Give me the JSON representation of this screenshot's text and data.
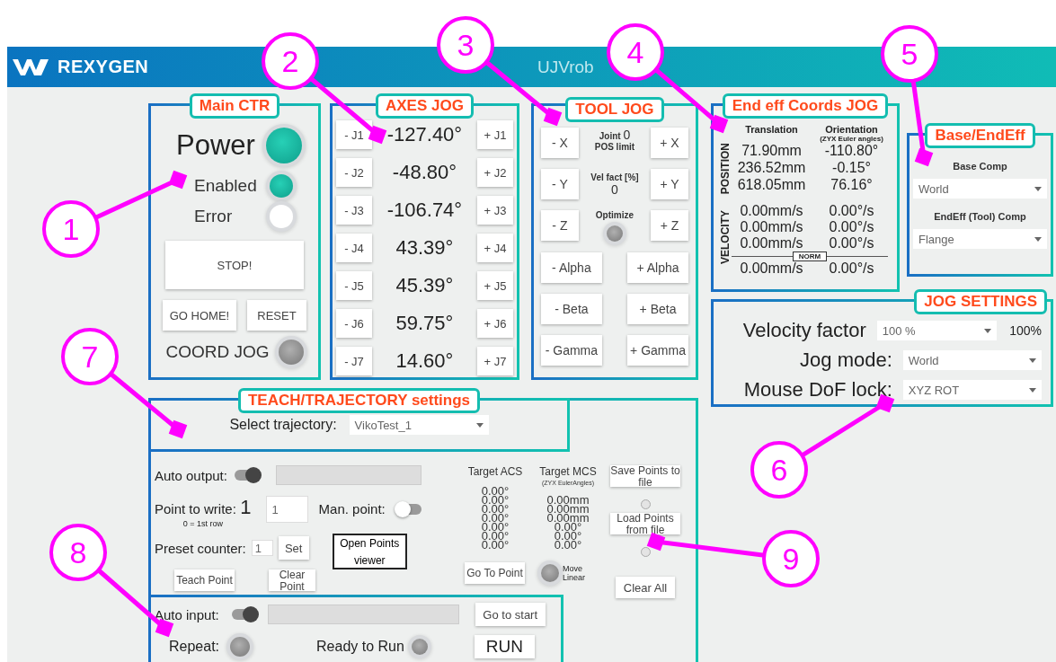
{
  "header": {
    "brand": "REXYGEN",
    "title": "UJVrob"
  },
  "main_ctr": {
    "title": "Main CTR",
    "indicators": [
      {
        "label": "Power",
        "on": true
      },
      {
        "label": "Enabled",
        "on": true
      },
      {
        "label": "Error",
        "on": false
      }
    ],
    "stop_button": "STOP!",
    "buttons": [
      "GO HOME!",
      "RESET"
    ],
    "coord_jog": {
      "label": "COORD JOG",
      "on": false
    }
  },
  "axes_jog": {
    "title": "AXES JOG",
    "joints": [
      {
        "minus": "- J1",
        "value": "-127.40°",
        "plus": "+ J1"
      },
      {
        "minus": "- J2",
        "value": "-48.80°",
        "plus": "+ J2"
      },
      {
        "minus": "- J3",
        "value": "-106.74°",
        "plus": "+ J3"
      },
      {
        "minus": "- J4",
        "value": "43.39°",
        "plus": "+ J4"
      },
      {
        "minus": "- J5",
        "value": "45.39°",
        "plus": "+ J5"
      },
      {
        "minus": "- J6",
        "value": "59.75°",
        "plus": "+ J6"
      },
      {
        "minus": "- J7",
        "value": "14.60°",
        "plus": "+ J7"
      }
    ]
  },
  "tool_jog": {
    "title": "TOOL JOG",
    "joint_label": "Joint",
    "joint_value": "0",
    "pos_limit": "POS limit",
    "vel_fact_label": "Vel fact  [%]",
    "vel_fact_value": "0",
    "optimize": {
      "label": "Optimize",
      "on": false
    },
    "linear_buttons": [
      {
        "minus": "- X",
        "plus": "+ X"
      },
      {
        "minus": "- Y",
        "plus": "+ Y"
      },
      {
        "minus": "- Z",
        "plus": "+ Z"
      }
    ],
    "angular_buttons": [
      {
        "minus": "- Alpha",
        "plus": "+ Alpha"
      },
      {
        "minus": "- Beta",
        "plus": "+ Beta"
      },
      {
        "minus": "- Gamma",
        "plus": "+ Gamma"
      }
    ]
  },
  "end_eff": {
    "title": "End eff Coords JOG",
    "translation_header": "Translation",
    "orientation_header": "Orientation",
    "orientation_note": "(ZYX Euler angles)",
    "position_label": "POSITION",
    "position_rows": [
      {
        "translation": "71.90mm",
        "orientation": "-110.80°"
      },
      {
        "translation": "236.52mm",
        "orientation": "-0.15°"
      },
      {
        "translation": "618.05mm",
        "orientation": "76.16°"
      }
    ],
    "velocity_label": "VELOCITY",
    "velocity_rows": [
      {
        "translation": "0.00mm/s",
        "orientation": "0.00°/s"
      },
      {
        "translation": "0.00mm/s",
        "orientation": "0.00°/s"
      },
      {
        "translation": "0.00mm/s",
        "orientation": "0.00°/s"
      }
    ],
    "norm_label": "NORM",
    "norm_row": {
      "translation": "0.00mm/s",
      "orientation": "0.00°/s"
    }
  },
  "base_endeff": {
    "title": "Base/EndEff",
    "fields": [
      {
        "label": "Base Comp",
        "value": "World"
      },
      {
        "label": "EndEff (Tool) Comp",
        "value": "Flange"
      }
    ]
  },
  "jog_settings": {
    "title": "JOG SETTINGS",
    "rows": [
      {
        "label": "Velocity factor",
        "value": "100 %",
        "reading": "100%"
      },
      {
        "label": "Jog mode:",
        "value": "World"
      },
      {
        "label": "Mouse DoF lock:",
        "value": "XYZ ROT"
      }
    ]
  },
  "teach": {
    "title": "TEACH/TRAJECTORY settings",
    "select_label": "Select trajectory:",
    "select_value": "VikoTest_1",
    "auto_output": {
      "label": "Auto output:",
      "on": true
    },
    "point_to_write": {
      "label": "Point to write:",
      "value": "1",
      "note": "0 = 1st row",
      "input": "1"
    },
    "man_point": {
      "label": "Man. point:",
      "on": false
    },
    "preset_counter": {
      "label": "Preset counter:",
      "input": "1",
      "button": "Set"
    },
    "open_viewer": "Open Points viewer",
    "teach_button": "Teach Point",
    "clear_button": "Clear Point",
    "target_acs": {
      "header": "Target ACS",
      "values": [
        "0.00°",
        "0.00°",
        "0.00°",
        "0.00°",
        "0.00°",
        "0.00°",
        "0.00°"
      ]
    },
    "target_mcs": {
      "header": "Target MCS",
      "note": "(ZYX EulerAngles)",
      "values": [
        "0.00mm",
        "0.00mm",
        "0.00mm",
        "0.00°",
        "0.00°",
        "0.00°"
      ]
    },
    "save_button": "Save Points to file",
    "save_status": {
      "on": false
    },
    "load_button": "Load Points from file",
    "load_status": {
      "on": false
    },
    "go_to_point": "Go To Point",
    "move_linear": {
      "label": "Move Linear",
      "on": false
    },
    "clear_all": "Clear All",
    "run": {
      "auto_input": {
        "label": "Auto input:",
        "on": true
      },
      "go_to_start": "Go to start",
      "repeat": {
        "label": "Repeat:",
        "on": false
      },
      "ready": {
        "label": "Ready to Run",
        "on": false
      },
      "run_button": "RUN"
    }
  },
  "callouts": [
    {
      "number": "1"
    },
    {
      "number": "2"
    },
    {
      "number": "3"
    },
    {
      "number": "4"
    },
    {
      "number": "5"
    },
    {
      "number": "6"
    },
    {
      "number": "7"
    },
    {
      "number": "8"
    },
    {
      "number": "9"
    }
  ]
}
